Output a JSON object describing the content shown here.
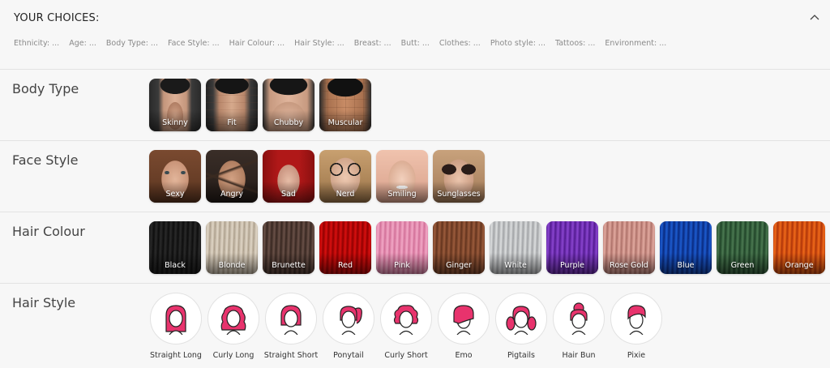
{
  "header": {
    "title": "YOUR CHOICES:",
    "choices": [
      "Ethnicity: ...",
      "Age: ...",
      "Body Type: ...",
      "Face Style: ...",
      "Hair Colour: ...",
      "Hair Style: ...",
      "Breast: ...",
      "Butt: ...",
      "Clothes: ...",
      "Photo style: ...",
      "Tattoos: ...",
      "Environment: ..."
    ]
  },
  "body_type": {
    "label": "Body Type",
    "options": [
      "Skinny",
      "Fit",
      "Chubby",
      "Muscular"
    ]
  },
  "face_style": {
    "label": "Face Style",
    "options": [
      "Sexy",
      "Angry",
      "Sad",
      "Nerd",
      "Smiling",
      "Sunglasses"
    ]
  },
  "hair_colour": {
    "label": "Hair Colour",
    "options": [
      "Black",
      "Blonde",
      "Brunette",
      "Red",
      "Pink",
      "Ginger",
      "White",
      "Purple",
      "Rose Gold",
      "Blue",
      "Green",
      "Orange"
    ]
  },
  "hair_style": {
    "label": "Hair Style",
    "options": [
      "Straight Long",
      "Curly Long",
      "Straight Short",
      "Ponytail",
      "Curly Short",
      "Emo",
      "Pigtails",
      "Hair Bun",
      "Pixie"
    ]
  },
  "colors": {
    "hair_icon": "#e8336d",
    "section_divider": "#e3e3e3"
  }
}
